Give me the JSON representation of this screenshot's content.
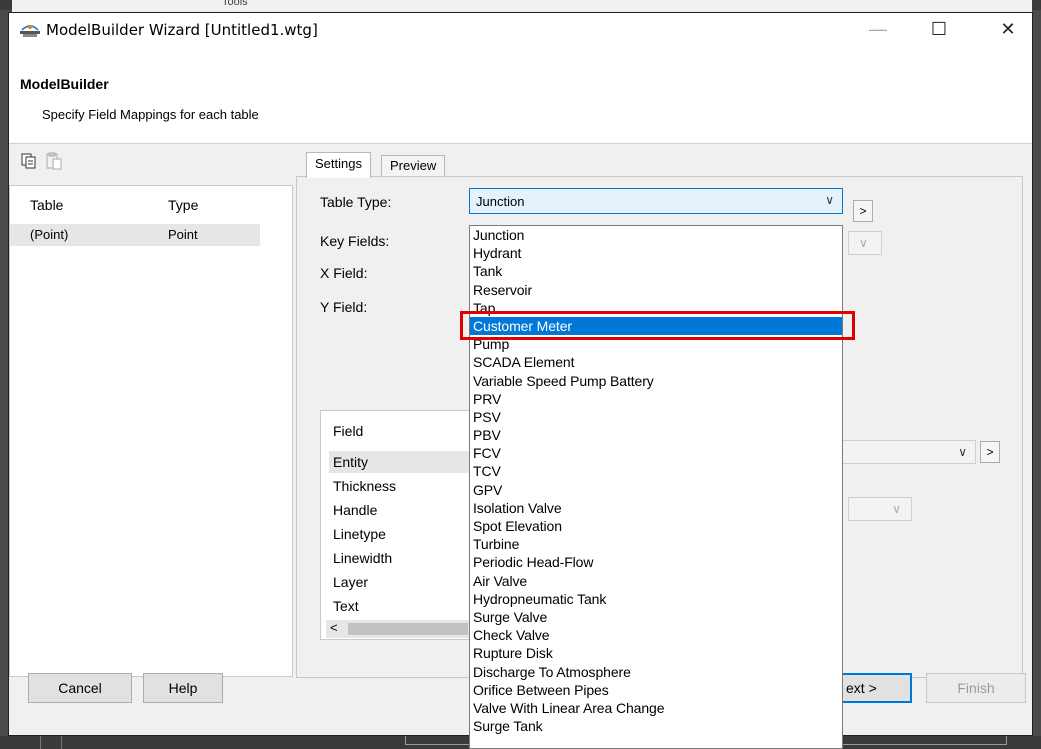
{
  "background": {
    "toolbar_label": "Tools"
  },
  "window": {
    "title": "ModelBuilder Wizard [Untitled1.wtg]",
    "minimize": "—",
    "maximize": "☐",
    "close": "✕"
  },
  "header": {
    "title": "ModelBuilder",
    "subtitle": "Specify Field Mappings for each table"
  },
  "table_list": {
    "columns": [
      "Table",
      "Type"
    ],
    "rows": [
      {
        "table": "(Point)",
        "type": "Point"
      }
    ]
  },
  "tabs": [
    "Settings",
    "Preview"
  ],
  "settings": {
    "table_type_label": "Table Type:",
    "table_type_value": "Junction",
    "key_fields_label": "Key Fields:",
    "x_field_label": "X Field:",
    "y_field_label": "Y Field:",
    "next_arrow": ">"
  },
  "field_grid": {
    "header": "Field",
    "rows": [
      "Entity",
      "Thickness",
      "Handle",
      "Linetype",
      "Linewidth",
      "Layer",
      "Text"
    ],
    "selected": "Entity",
    "scroll_left": "<"
  },
  "dropdown": {
    "selected": "Customer Meter",
    "items": [
      "Junction",
      "Hydrant",
      "Tank",
      "Reservoir",
      "Tap",
      "Customer Meter",
      "Pump",
      "SCADA Element",
      "Variable Speed Pump Battery",
      "PRV",
      "PSV",
      "PBV",
      "FCV",
      "TCV",
      "GPV",
      "Isolation Valve",
      "Spot Elevation",
      "Turbine",
      "Periodic Head-Flow",
      "Air Valve",
      "Hydropneumatic Tank",
      "Surge Valve",
      "Check Valve",
      "Rupture Disk",
      "Discharge To Atmosphere",
      "Orifice Between Pipes",
      "Valve With Linear Area Change",
      "Surge Tank"
    ]
  },
  "buttons": {
    "cancel": "Cancel",
    "help": "Help",
    "next": "ext >",
    "finish": "Finish"
  },
  "colors": {
    "selection": "#0078d7",
    "highlight_box": "#e00000"
  }
}
